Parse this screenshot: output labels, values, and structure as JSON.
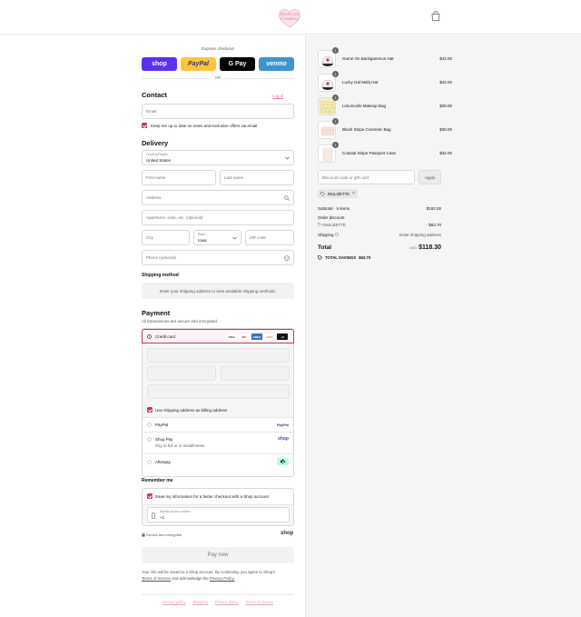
{
  "header": {
    "logo_text": "Blossom Cowboy",
    "bag_icon": "shopping-bag-icon"
  },
  "express": {
    "title": "Express checkout",
    "buttons": [
      {
        "label": "shop",
        "bg": "#5a31f4",
        "fg": "#ffffff"
      },
      {
        "label": "PayPal",
        "bg": "#ffc439",
        "fg": "#253b80"
      },
      {
        "label": "G Pay",
        "bg": "#000000",
        "fg": "#ffffff"
      },
      {
        "label": "venmo",
        "bg": "#3d95ce",
        "fg": "#ffffff"
      }
    ],
    "or": "OR"
  },
  "contact": {
    "heading": "Contact",
    "login": "Log in",
    "email_placeholder": "Email",
    "newsletter": "Keep me up to date on news and exclusive offers via email"
  },
  "delivery": {
    "heading": "Delivery",
    "country_label": "Country/Region",
    "country_value": "United States",
    "first_name": "First name",
    "last_name": "Last name",
    "address": "Address",
    "apartment": "Apartment, suite, etc. (optional)",
    "city": "City",
    "state_label": "State",
    "state_value": "Iowa",
    "zip": "ZIP code",
    "phone": "Phone (optional)"
  },
  "shipping": {
    "heading": "Shipping method",
    "note": "Enter your shipping address to view available shipping methods."
  },
  "payment": {
    "heading": "Payment",
    "note": "All transactions are secure and encrypted.",
    "credit_card": "Credit card",
    "card_icons": [
      {
        "label": "VISA",
        "bg": "#ffffff",
        "fg": "#1a1f71"
      },
      {
        "label": "MC",
        "bg": "#ffffff",
        "fg": "#eb001b"
      },
      {
        "label": "AMEX",
        "bg": "#2e77bc",
        "fg": "#ffffff"
      },
      {
        "label": "DISC",
        "bg": "#ffffff",
        "fg": "#f48120"
      },
      {
        "label": "+3",
        "bg": "#111111",
        "fg": "#ffffff"
      }
    ],
    "billing_same": "Use shipping address as billing address",
    "paypal": "PayPal",
    "paypal_logo": "PayPal",
    "shop_pay": "Shop Pay",
    "shop_pay_sub": "Pay in full or in installments",
    "shop_logo": "shop",
    "afterpay": "Afterpay"
  },
  "remember": {
    "heading": "Remember me",
    "save_info": "Save my information for a faster checkout with a Shop account",
    "phone_label": "Mobile phone number",
    "phone_value": "+1",
    "secure": "Secure and encrypted",
    "shop_logo": "shop"
  },
  "pay_now": "Pay now",
  "legal": {
    "text": "Your info will be saved to a Shop account. By continuing, you agree to Shop's",
    "tos": "Terms of Service",
    "and": "and acknowledge the",
    "privacy": "Privacy Policy."
  },
  "footer": [
    "Refund policy",
    "Shipping",
    "Privacy policy",
    "Terms of service"
  ],
  "summary": {
    "items": [
      {
        "name": "Game On Backgammon Hat",
        "price": "$42.00",
        "qty": "1"
      },
      {
        "name": "Lucky Gal Mahj Hat",
        "price": "$42.00",
        "qty": "1"
      },
      {
        "name": "Limoncello Makeup Bag",
        "price": "$28.00",
        "qty": "1"
      },
      {
        "name": "Blush Stripe Cosmetic Bag",
        "price": "$38.00",
        "qty": "1"
      },
      {
        "name": "Coastal Stripe Passport Case",
        "price": "$32.00",
        "qty": "1"
      }
    ],
    "discount_placeholder": "Discount code or gift card",
    "apply": "Apply",
    "code_chip": "INULIZETTE",
    "subtotal_label": "Subtotal · 5 items",
    "subtotal": "$182.00",
    "order_discount": "Order discount",
    "discount_code": "INULIZETTE",
    "discount_amount": "- $63.70",
    "shipping_label": "Shipping",
    "shipping_value": "Enter shipping address",
    "total_label": "Total",
    "currency": "USD",
    "total": "$118.30",
    "savings_label": "TOTAL SAVINGS",
    "savings": "$63.70"
  },
  "colors": {
    "accent": "#c2385f",
    "link_pink": "#e9789a"
  }
}
